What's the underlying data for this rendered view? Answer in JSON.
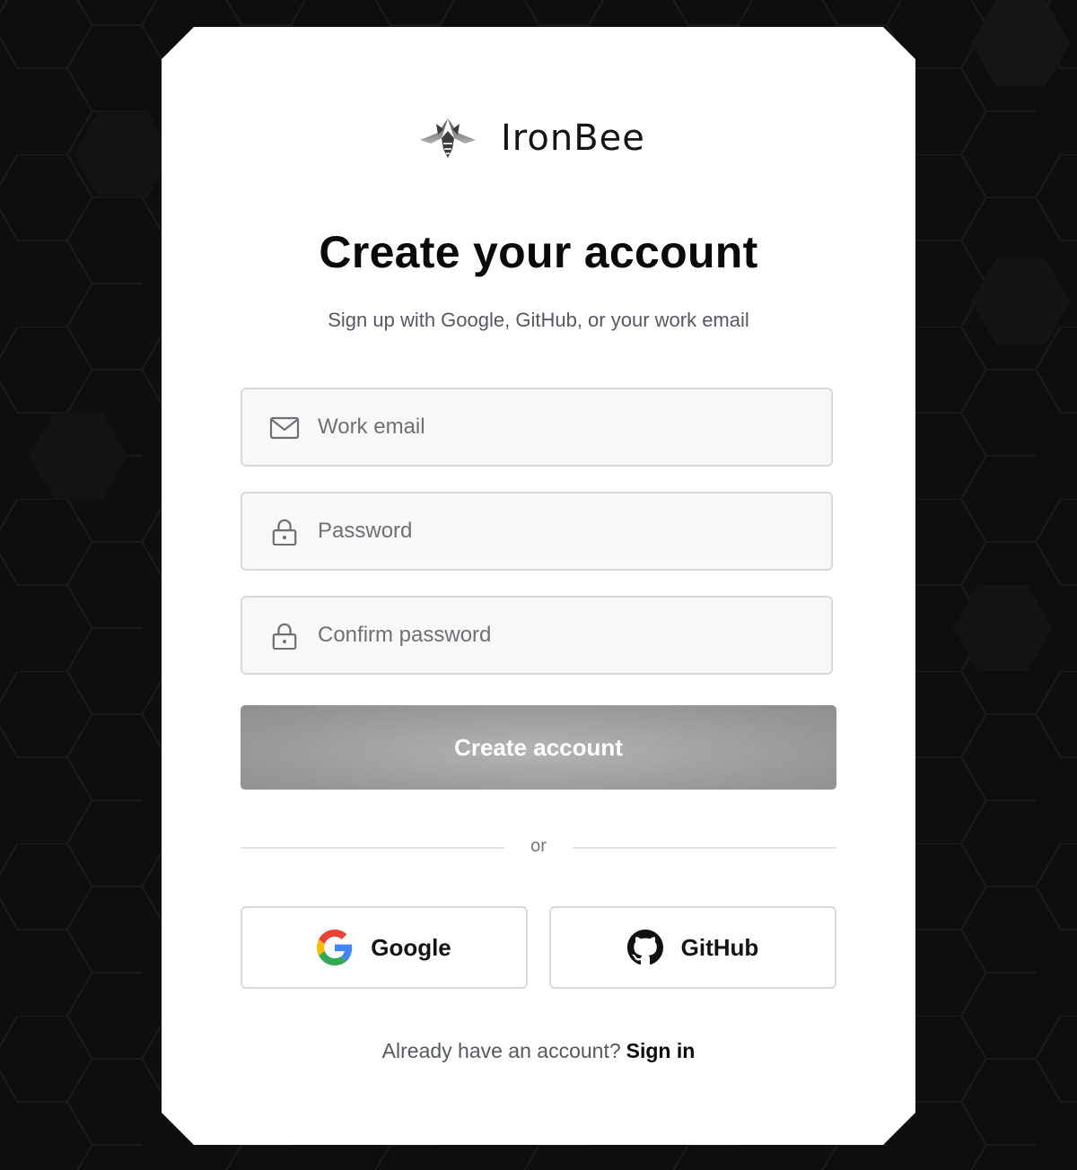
{
  "brand": {
    "name": "IronBee",
    "logo_icon": "bee-logo-icon"
  },
  "page": {
    "title": "Create your account",
    "subtitle": "Sign up with Google, GitHub, or your work email"
  },
  "form": {
    "email": {
      "placeholder": "Work email",
      "value": "",
      "icon": "mail-icon"
    },
    "password": {
      "placeholder": "Password",
      "value": "",
      "icon": "lock-icon"
    },
    "confirm": {
      "placeholder": "Confirm password",
      "value": "",
      "icon": "lock-icon"
    },
    "submit_label": "Create account"
  },
  "divider_label": "or",
  "social": {
    "google": {
      "label": "Google",
      "icon": "google-icon"
    },
    "github": {
      "label": "GitHub",
      "icon": "github-icon"
    }
  },
  "footer": {
    "prompt": "Already have an account?",
    "link_label": "Sign in"
  },
  "colors": {
    "background": "#0e0e0e",
    "card": "#ffffff",
    "button_disabled": "#a1a1a3",
    "field_bg": "#f8f8f8",
    "field_border": "#d8d9dc"
  }
}
